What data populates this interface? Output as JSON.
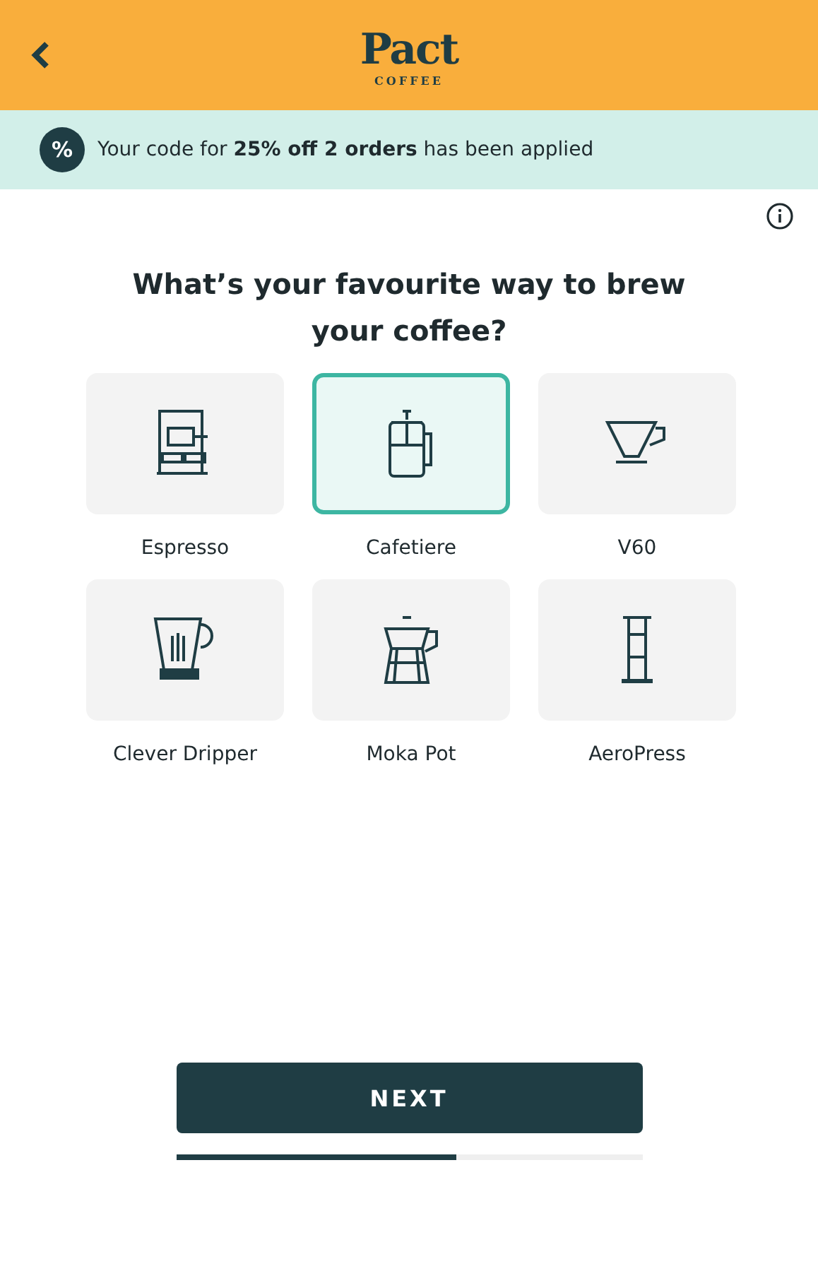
{
  "header": {
    "logo": "Pact",
    "logo_sub": "COFFEE"
  },
  "banner": {
    "text": "Your code for **25% off 2 orders** has been applied",
    "badge": "%"
  },
  "question": "What’s your favourite way to brew your coffee?",
  "options": [
    {
      "label": "Espresso",
      "kind": "espresso",
      "selected": false
    },
    {
      "label": "Cafetiere",
      "kind": "cafetiere",
      "selected": true
    },
    {
      "label": "V60",
      "kind": "v60",
      "selected": false
    },
    {
      "label": "Clever Dripper",
      "kind": "dripper",
      "selected": false
    },
    {
      "label": "Moka Pot",
      "kind": "moka",
      "selected": false
    },
    {
      "label": "AeroPress",
      "kind": "aeropress",
      "selected": false
    }
  ],
  "next_button": "NEXT",
  "progress": {
    "level": 0.6
  }
}
